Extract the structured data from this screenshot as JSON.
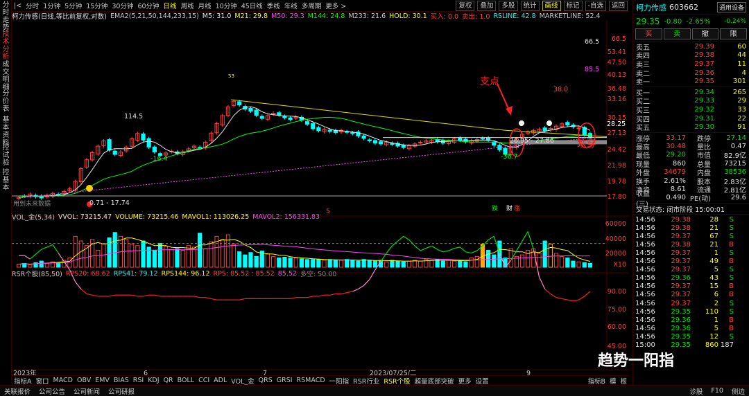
{
  "left_tabs": [
    "分时走势",
    "技术分析",
    "成交明细",
    "分价表",
    "基本资料",
    "控试验",
    "控基本"
  ],
  "topbar": {
    "periods": [
      "分时",
      "1分钟",
      "5分钟",
      "15分钟",
      "30分钟",
      "60分钟",
      "日线",
      "周线",
      "月线",
      "10分钟",
      "45日线",
      "季线",
      "年线",
      "多周期",
      "更多 >"
    ],
    "active_period": "日线",
    "right_buttons": [
      "复权",
      "叠加",
      "多股",
      "统计",
      "画线",
      "标记",
      "-自选",
      "返回"
    ],
    "active_right": "画线"
  },
  "indicator_line": {
    "name": "柯力传感(日线,等比前复权,对数)",
    "items": [
      {
        "t": "EMA2(5,21,50,144,233,15)",
        "c": "#c8c8c8"
      },
      {
        "t": "M5: 31.0",
        "c": "#e8e8e8"
      },
      {
        "t": "M21: 29.8",
        "c": "#ffff00"
      },
      {
        "t": "M50: 29.3",
        "c": "#ff44ff"
      },
      {
        "t": "M144: 24.8",
        "c": "#00ff00"
      },
      {
        "t": "M233: 21.6",
        "c": "#c8c8c8"
      },
      {
        "t": "HOLD: 30.1",
        "c": "#ffff00"
      },
      {
        "t": "买入: 0.0",
        "c": "#ff4040"
      },
      {
        "t": "卖出: 1.0",
        "c": "#ff4040"
      },
      {
        "t": "RSLINE: 42.8",
        "c": "#00ffff"
      },
      {
        "t": "MARKETLINE: 52.4",
        "c": "#c8c8c8"
      }
    ]
  },
  "vol_line": {
    "items": [
      {
        "t": "VOL_金(5,34)",
        "c": "#c8c8c8"
      },
      {
        "t": "VVOL: 73215.47",
        "c": "#e8e8e8"
      },
      {
        "t": "VOLUME: 73215.46",
        "c": "#ffff00"
      },
      {
        "t": "MAVOL1: 113026.25",
        "c": "#ffff00"
      },
      {
        "t": "MAVOL2: 156331.83",
        "c": "#ff44ff"
      }
    ]
  },
  "rsr_line": {
    "items": [
      {
        "t": "RSR个股(85,50)",
        "c": "#c8c8c8"
      },
      {
        "t": "RPS20: 68.62",
        "c": "#ff4040"
      },
      {
        "t": "RPS41: 79.12",
        "c": "#00ffff"
      },
      {
        "t": "RPS144: 96.12",
        "c": "#ffff00"
      },
      {
        "t": "RPS: 85.52 : 85.52",
        "c": "#ff4040"
      },
      {
        "t": "85.52",
        "c": "#ff44ff"
      },
      {
        "t": "多空: 50.00",
        "c": "#888888"
      }
    ]
  },
  "price_axis": [
    "66.5",
    "53.41",
    "47.50",
    "40.13",
    "36.48",
    "33.16",
    "30.15",
    "27.13",
    "24.42",
    "21.98",
    "19.78",
    "17.80"
  ],
  "vol_axis": [
    "60000",
    "40000",
    "20000",
    "X10"
  ],
  "rsr_axis": [
    "90.00",
    "75.00",
    "60.00",
    "45.00"
  ],
  "x_labels": [
    "2023年",
    "6",
    "7",
    "2023/07/25/二",
    "9"
  ],
  "chart_annotations": {
    "support_label": "支点",
    "break_label": "跌穿",
    "high_label": "114.5",
    "low_label": "-16.4",
    "low2_label": "-36.7",
    "range_label": "26.95 - 27.86",
    "start_label": "0.71 - 17.74",
    "peak_label": "38.0",
    "hold_label": "28.25",
    "future_label": "用到未来数据",
    "pk_label": "85.5",
    "tag_die": "跌",
    "tag_cai": "财",
    "tag_zhang": "涨",
    "marker_five": "5",
    "marker_top": "53"
  },
  "bottom_tabs": [
    "指标A",
    "窗口",
    "MACD",
    "OBV",
    "EMV",
    "BIAS",
    "RSI",
    "KDJ",
    "QR",
    "BOLL",
    "CCI",
    "ADL",
    "VOL_金",
    "QRS",
    "GRSI",
    "RSMACD",
    "一阳指",
    "RSR行业",
    "RSR个股",
    "超量底部突破",
    "更多",
    "设置",
    "指标B",
    "模",
    "板"
  ],
  "bottom_active": "RSR个股",
  "status_bar": [
    "关联报价",
    "公司公告",
    "公司新闻",
    "公司研报",
    "诊股",
    "F10",
    "侧边"
  ],
  "stock": {
    "name": "柯力传感",
    "code": "603662",
    "price": "29.35",
    "change": "-0.80",
    "pct": "-2.65%",
    "button": "通用设备",
    "button_pct": "-0.24%"
  },
  "trade_buttons": [
    "买",
    "卖",
    "撤",
    "限"
  ],
  "asks": [
    {
      "l": "卖五",
      "p": "29.39",
      "v": "60"
    },
    {
      "l": "卖四",
      "p": "29.38",
      "v": "44"
    },
    {
      "l": "卖三",
      "p": "29.37",
      "v": "11"
    },
    {
      "l": "卖二",
      "p": "29.36",
      "v": "4"
    },
    {
      "l": "卖一",
      "p": "29.35",
      "v": "301"
    }
  ],
  "bids": [
    {
      "l": "买一",
      "p": "29.34",
      "v": "265"
    },
    {
      "l": "买二",
      "p": "29.33",
      "v": "29"
    },
    {
      "l": "买三",
      "p": "29.32",
      "v": "33"
    },
    {
      "l": "买四",
      "p": "29.31",
      "v": "22"
    },
    {
      "l": "买五",
      "p": "29.30",
      "v": "91"
    }
  ],
  "stats": [
    {
      "a": "涨停",
      "av": "33.17",
      "b": "跌停",
      "bv": "27.14",
      "ac": "red",
      "bc": "green"
    },
    {
      "a": "最高",
      "av": "30.48",
      "b": "量比",
      "bv": "0.47",
      "ac": "red",
      "bc": "white"
    },
    {
      "a": "最低",
      "av": "29.20",
      "b": "市值",
      "bv": "82.9亿",
      "ac": "green",
      "bc": "white"
    },
    {
      "a": "现量",
      "av": "860",
      "b": "总量",
      "bv": "73215",
      "ac": "white",
      "bc": "white"
    },
    {
      "a": "外盘",
      "av": "34679",
      "b": "内盘",
      "bv": "38536",
      "ac": "red",
      "bc": "green"
    },
    {
      "a": "换手",
      "av": "2.61%",
      "b": "股本",
      "bv": "2.83亿",
      "ac": "white",
      "bc": "white"
    },
    {
      "a": "净资",
      "av": "8.61",
      "b": "流通",
      "bv": "2.81亿",
      "ac": "white",
      "bc": "white"
    },
    {
      "a": "收益(三)",
      "av": "0.490",
      "b": "PE(动)",
      "bv": "29.6",
      "ac": "white",
      "bc": "white"
    }
  ],
  "trade_status": "交易状态: 闭市阶段 15:00:01",
  "ticks": [
    {
      "t": "14:56",
      "p": "29.38",
      "v": "28",
      "d": "S"
    },
    {
      "t": "14:56",
      "p": "29.38",
      "v": "21",
      "d": "S"
    },
    {
      "t": "14:56",
      "p": "29.37",
      "v": "67",
      "d": "S"
    },
    {
      "t": "14:56",
      "p": "29.38",
      "v": "21",
      "d": "B"
    },
    {
      "t": "14:56",
      "p": "29.37",
      "v": "1",
      "d": "S"
    },
    {
      "t": "14:56",
      "p": "29.37",
      "v": "49",
      "d": "B"
    },
    {
      "t": "14:56",
      "p": "29.37",
      "v": "5",
      "d": "S"
    },
    {
      "t": "14:56",
      "p": "29.36",
      "v": "43",
      "d": "S"
    },
    {
      "t": "14:56",
      "p": "29.37",
      "v": "15",
      "d": "B"
    },
    {
      "t": "14:56",
      "p": "29.37",
      "v": "6",
      "d": "B"
    },
    {
      "t": "14:56",
      "p": "29.37",
      "v": "2",
      "d": "S"
    },
    {
      "t": "14:56",
      "p": "29.35",
      "v": "110",
      "d": "S"
    },
    {
      "t": "14:56",
      "p": "29.36",
      "v": "1",
      "d": "B"
    },
    {
      "t": "14:56",
      "p": "29.36",
      "v": "5",
      "d": "B"
    },
    {
      "t": "14:56",
      "p": "29.35",
      "v": "12",
      "d": "S"
    },
    {
      "t": "15:00",
      "p": "29.35",
      "v": "860",
      "d": "187"
    }
  ],
  "watermark": "趋势一阳指",
  "colors": {
    "up": "#ff4040",
    "down": "#00ffff",
    "bg": "#000000",
    "grid": "#3a0000"
  }
}
